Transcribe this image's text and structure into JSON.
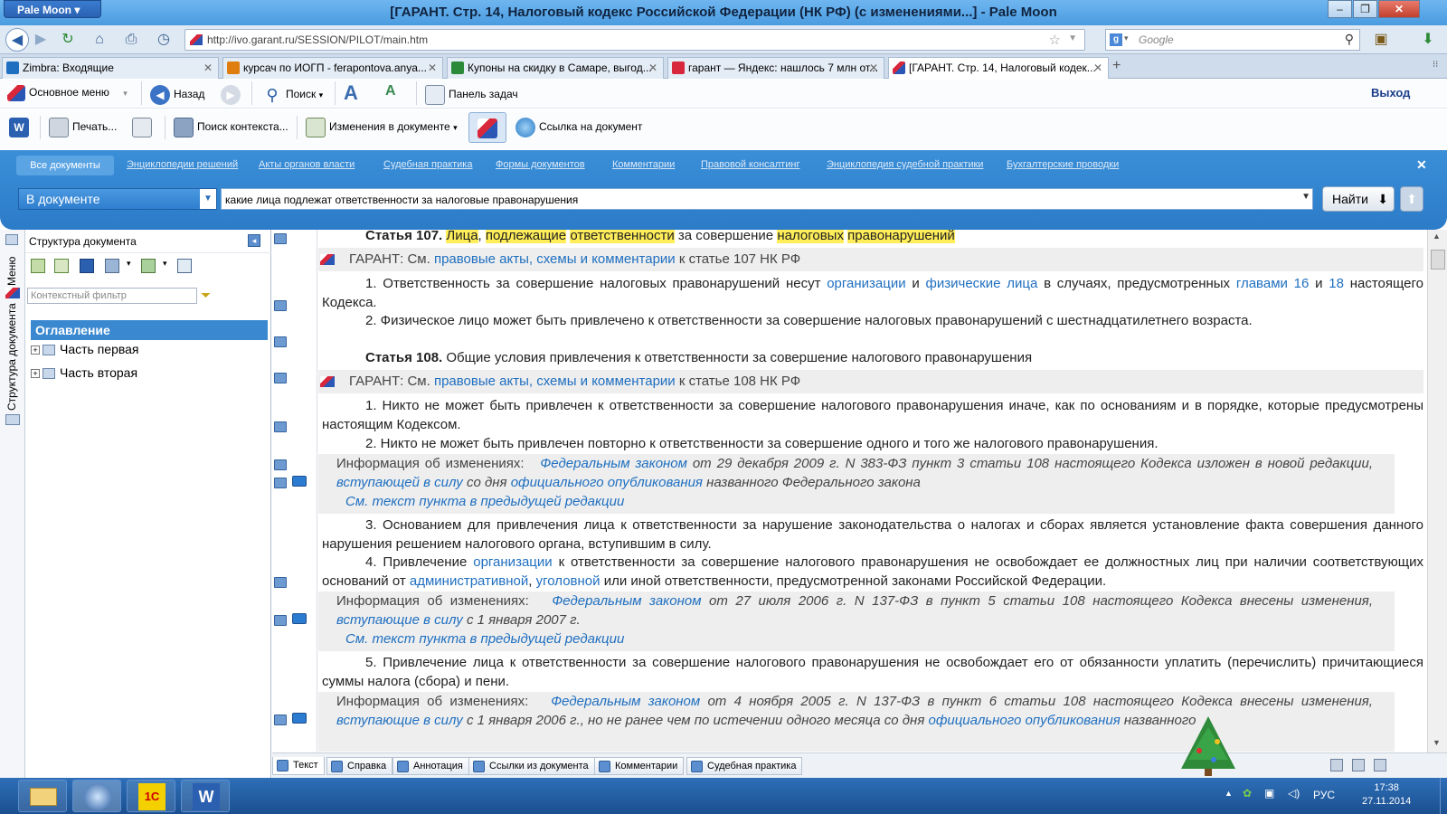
{
  "browser": {
    "app_button": "Pale Moon",
    "window_title": "[ГАРАНТ. Стр. 14, Налоговый кодекс Российской Федерации (НК РФ) (с изменениями...] - Pale Moon",
    "url": "http://ivo.garant.ru/SESSION/PILOT/main.htm",
    "search_placeholder": "Google",
    "tabs": [
      {
        "label": "Zimbra: Входящие",
        "color": "#1f6fc0"
      },
      {
        "label": "курсач по ИОГП - ferapontova.anya...",
        "color": "#e07d10"
      },
      {
        "label": "Купоны на скидку в Самаре, выгод...",
        "color": "#2a8a3a"
      },
      {
        "label": "гарант — Яндекс: нашлось 7 млн от...",
        "color": "#d8273b"
      },
      {
        "label": "[ГАРАНТ. Стр. 14, Налоговый кодек...",
        "color": "#d8273b"
      }
    ]
  },
  "garant_toolbar": {
    "main_menu": "Основное меню",
    "back": "Назад",
    "search": "Поиск",
    "taskpanel": "Панель задач",
    "exit": "Выход",
    "print": "Печать...",
    "context_search": "Поиск контекста...",
    "doc_changes": "Изменения в документе",
    "doc_link": "Ссылка на документ"
  },
  "search_panel": {
    "tabs": [
      "Все документы",
      "Энциклопедии решений",
      "Акты органов власти",
      "Судебная практика",
      "Формы документов",
      "Комментарии",
      "Правовой консалтинг",
      "Энциклопедия судебной практики",
      "Бухгалтерские проводки"
    ],
    "scope": "В документе",
    "query": "какие лица подлежат ответственности за налоговые правонарушения",
    "find_button": "Найти"
  },
  "left_panel": {
    "title": "Структура документа",
    "filter_placeholder": "Контекстный фильтр",
    "vertical_menu": "Меню",
    "vertical_structure": "Структура документа",
    "toc_header": "Оглавление",
    "toc_items": [
      "Часть первая",
      "Часть вторая"
    ]
  },
  "document": {
    "art107_prefix": "Статья 107.",
    "art107_words": [
      "Лица",
      ",",
      "подлежащие",
      "ответственности",
      "за совершение",
      "налоговых",
      "правонарушений"
    ],
    "garant_see": "ГАРАНТ: См.",
    "garant_link": "правовые акты, схемы и комментарии",
    "garant_107_tail": "к статье 107 НК РФ",
    "p107_1_a": "1. Ответственность за совершение налоговых правонарушений несут",
    "p107_1_link1": "организации",
    "p107_1_and": "и",
    "p107_1_link2": "физические лица",
    "p107_1_b": "в случаях, предусмотренных",
    "p107_1_link3": "главами 16",
    "p107_1_and2": "и",
    "p107_1_link4": "18",
    "p107_1_c": "настоящего Кодекса.",
    "p107_2": "2. Физическое лицо может быть привлечено к ответственности за совершение налоговых правонарушений с шестнадцатилетнего возраста.",
    "art108_prefix": "Статья 108.",
    "art108_title": "Общие условия привлечения к ответственности за совершение налогового правонарушения",
    "garant_108_tail": "к статье 108 НК РФ",
    "p108_1": "1. Никто не может быть привлечен к ответственности за совершение налогового правонарушения иначе, как по основаниям и в порядке, которые предусмотрены настоящим Кодексом.",
    "p108_2": "2. Никто не может быть привлечен повторно к ответственности за совершение одного и того же налогового правонарушения.",
    "info_label": "Информация об изменениях:",
    "info1_link1": "Федеральным законом",
    "info1_a": "от 29 декабря 2009 г. N 383-ФЗ пункт 3 статьи 108 настоящего Кодекса изложен в новой редакции,",
    "info1_link2": "вступающей в силу",
    "info1_b": "со дня",
    "info1_link3": "официального опубликования",
    "info1_c": "названного Федерального закона",
    "prev_edition": "См. текст пункта в предыдущей редакции",
    "p108_3": "3. Основанием для привлечения лица к ответственности за нарушение законодательства о налогах и сборах является установление факта совершения данного нарушения решением налогового органа, вступившим в силу.",
    "p108_4_a": "4. Привлечение",
    "p108_4_link1": "организации",
    "p108_4_b": "к ответственности за совершение налогового правонарушения не освобождает ее должностных лиц при наличии соответствующих оснований от",
    "p108_4_link2": "административной",
    "p108_4_comma": ",",
    "p108_4_link3": "уголовной",
    "p108_4_c": "или иной ответственности, предусмотренной законами Российской Федерации.",
    "info2_link1": "Федеральным законом",
    "info2_a": "от 27 июля 2006 г. N 137-ФЗ в пункт 5 статьи 108 настоящего Кодекса внесены изменения,",
    "info2_link2": "вступающие в силу",
    "info2_b": "с 1 января 2007 г.",
    "p108_5": "5. Привлечение лица к ответственности за совершение налогового правонарушения не освобождает его от обязанности уплатить (перечислить) причитающиеся суммы налога (сбора) и пени.",
    "info3_link1": "Федеральным законом",
    "info3_a": "от 4 ноября 2005 г. N 137-ФЗ в пункт 6 статьи 108 настоящего Кодекса внесены изменения,",
    "info3_link2": "вступающие в силу",
    "info3_b": "с 1 января 2006 г., но не ранее чем по истечении одного месяца со дня",
    "info3_link3": "официального опубликования",
    "info3_c": "названного"
  },
  "doc_tabs": [
    "Текст",
    "Справка",
    "Аннотация",
    "Ссылки из документа",
    "Комментарии",
    "Судебная практика"
  ],
  "taskbar": {
    "apps": [
      "file-explorer-icon",
      "pale-moon-icon",
      "1c-icon",
      "word-icon"
    ],
    "lang": "РУС",
    "time": "17:38",
    "date": "27.11.2014"
  }
}
